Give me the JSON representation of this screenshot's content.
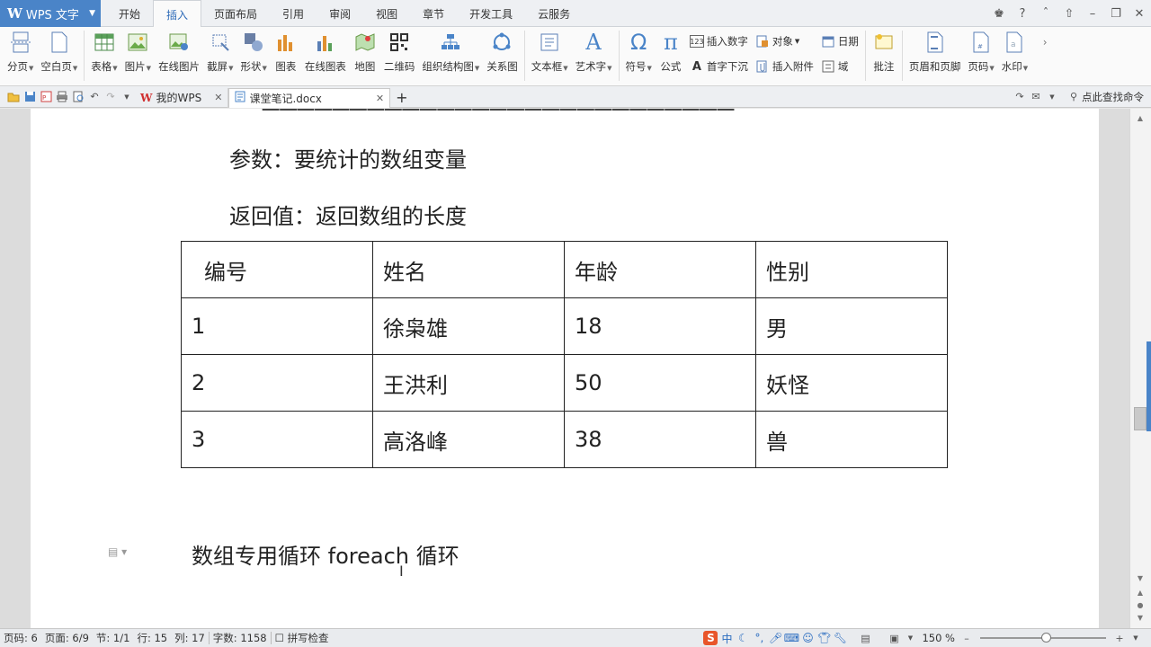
{
  "app": {
    "title": "WPS 文字",
    "logo": "W"
  },
  "menu": {
    "tabs": [
      "开始",
      "插入",
      "页面布局",
      "引用",
      "审阅",
      "视图",
      "章节",
      "开发工具",
      "云服务"
    ],
    "active": "插入",
    "help": "?"
  },
  "ribbon": {
    "page_break": "分页",
    "blank_page": "空白页",
    "table": "表格",
    "picture": "图片",
    "online_picture": "在线图片",
    "screenshot": "截屏",
    "shapes": "形状",
    "chart": "图表",
    "online_chart": "在线图表",
    "map": "地图",
    "qrcode": "二维码",
    "org_chart": "组织结构图",
    "relation_chart": "关系图",
    "textbox": "文本框",
    "wordart": "艺术字",
    "symbol": "符号",
    "formula": "公式",
    "insert_number": "插入数字",
    "object": "对象",
    "date": "日期",
    "drop_cap": "首字下沉",
    "insert_attachment": "插入附件",
    "field": "域",
    "comment": "批注",
    "header_footer": "页眉和页脚",
    "page_number": "页码",
    "watermark": "水印"
  },
  "tabs": {
    "home": "我的WPS",
    "doc": "课堂笔记.docx",
    "find_command": "点此查找命令"
  },
  "document": {
    "param_line": "参数：要统计的数组变量",
    "return_line": "返回值：返回数组的长度",
    "table": {
      "headers": [
        "编号",
        "姓名",
        "年龄",
        "性别"
      ],
      "rows": [
        [
          "1",
          "徐枭雄",
          "18",
          "男"
        ],
        [
          "2",
          "王洪利",
          "50",
          "妖怪"
        ],
        [
          "3",
          "高洛峰",
          "38",
          "兽"
        ]
      ]
    },
    "heading": "数组专用循环  foreach 循环"
  },
  "status": {
    "page_code": "页码: 6",
    "page": "页面: 6/9",
    "section": "节: 1/1",
    "row": "行: 15",
    "col": "列: 17",
    "word_count": "字数: 1158",
    "spell_check": "拼写检查",
    "ime_lang": "中",
    "zoom": "150 %"
  }
}
